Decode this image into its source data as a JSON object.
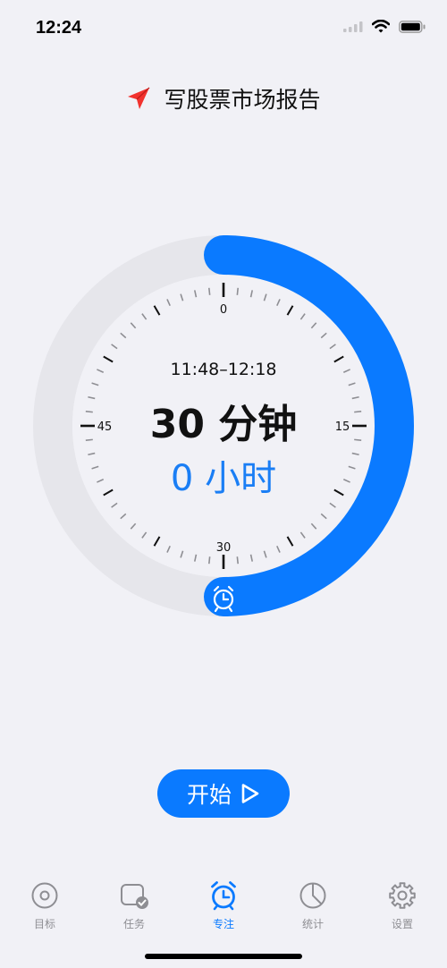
{
  "status_bar": {
    "time": "12:24"
  },
  "header": {
    "task_title": "写股票市场报告"
  },
  "timer": {
    "time_range": "11:48–12:18",
    "duration": "30 分钟",
    "hours": "0 小时",
    "tick_labels": [
      "0",
      "15",
      "30",
      "45"
    ],
    "elapsed_fraction": 0.5
  },
  "start_button": {
    "label": "开始"
  },
  "tabs": [
    {
      "label": "目标",
      "icon": "target-icon",
      "active": false
    },
    {
      "label": "任务",
      "icon": "task-check-icon",
      "active": false
    },
    {
      "label": "专注",
      "icon": "alarm-clock-icon",
      "active": true
    },
    {
      "label": "统计",
      "icon": "pie-chart-icon",
      "active": false
    },
    {
      "label": "设置",
      "icon": "gear-icon",
      "active": false
    }
  ],
  "colors": {
    "accent": "#0a7aff",
    "background": "#f1f1f6",
    "track": "#e6e6eb"
  }
}
